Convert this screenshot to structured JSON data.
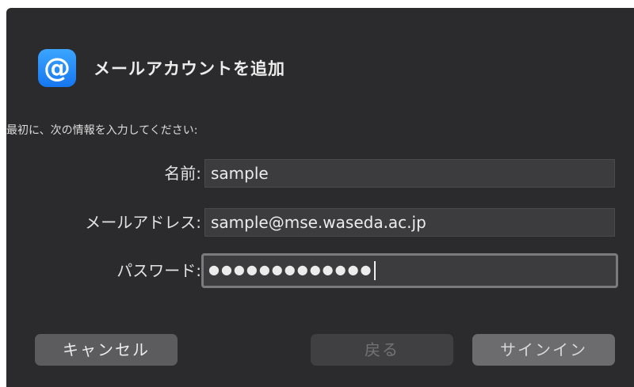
{
  "dialog": {
    "title": "メールアカウントを追加",
    "icon": "@",
    "subtitle": "最初に、次の情報を入力してください:"
  },
  "form": {
    "name_label": "名前:",
    "name_value": "sample",
    "email_label": "メールアドレス:",
    "email_value": "sample@mse.waseda.ac.jp",
    "password_label": "パスワード:",
    "password_value": "●●●●●●●●●●●●●"
  },
  "buttons": {
    "cancel": "キャンセル",
    "back": "戻る",
    "signin": "サインイン"
  }
}
